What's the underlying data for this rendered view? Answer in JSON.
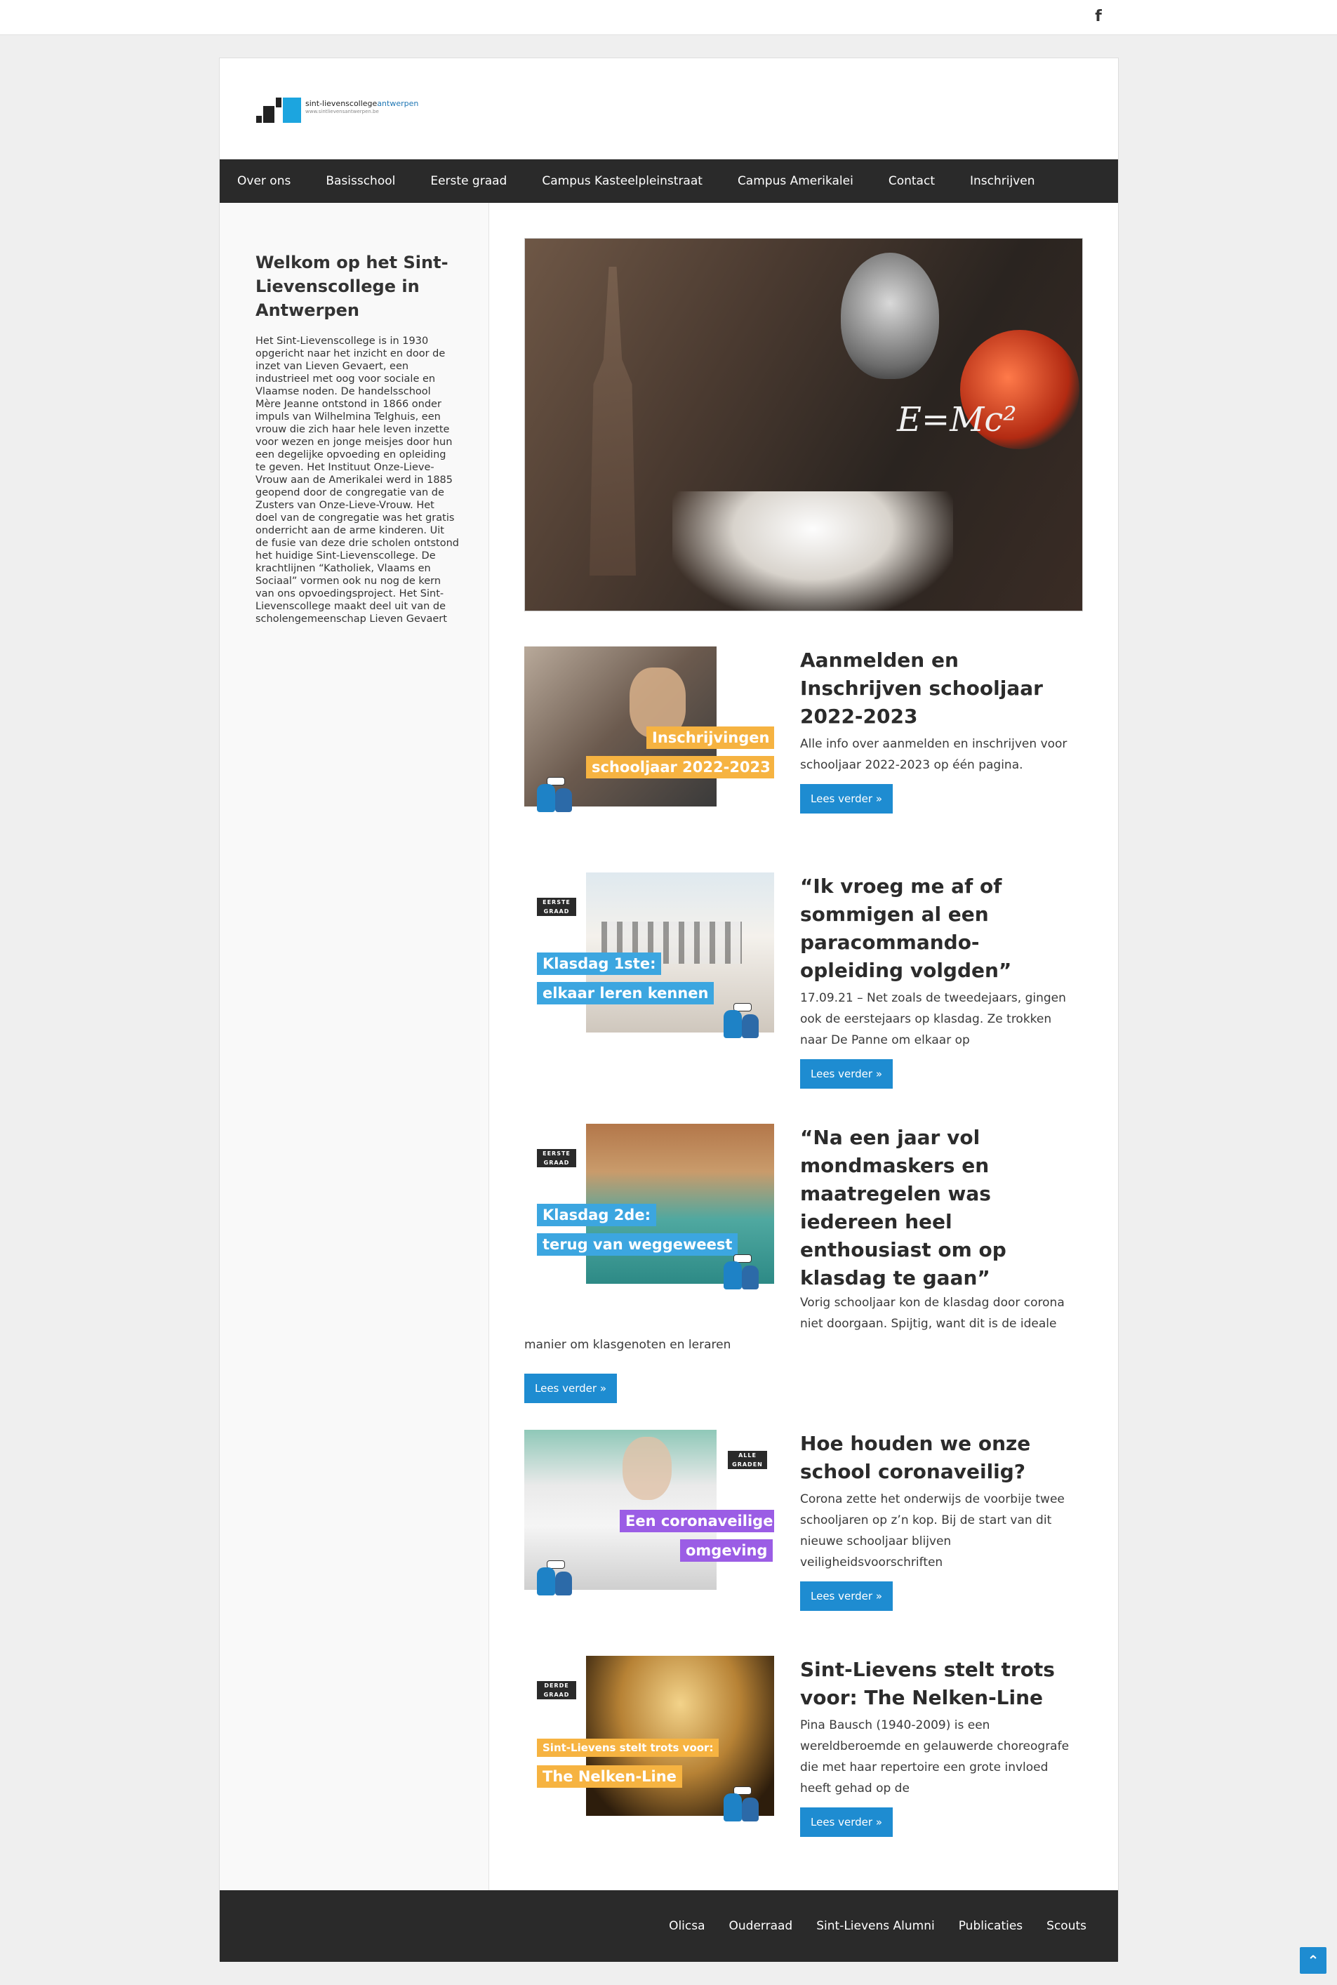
{
  "topbar": {
    "social_icon": "facebook-icon",
    "social_glyph": "f"
  },
  "logo": {
    "name_bold": "sint-lievenscollege",
    "name_accent": "antwerpen",
    "url": "www.sintlievensantwerpen.be"
  },
  "nav": {
    "items": [
      "Over ons",
      "Basisschool",
      "Eerste graad",
      "Campus Kasteelpleinstraat",
      "Campus Amerikalei",
      "Contact",
      "Inschrijven"
    ]
  },
  "sidebar": {
    "title": "Welkom op het Sint-Lievenscollege in Antwerpen",
    "about": "Het Sint-Lievenscollege is in 1930 opgericht naar het inzicht en door de inzet van Lieven Gevaert, een industrieel met oog voor sociale en Vlaamse noden. De handelsschool Mère Jeanne ontstond in 1866 onder impuls van Wilhelmina Telghuis, een vrouw die zich haar hele leven inzette voor wezen en jonge meisjes door hun een degelijke opvoeding en opleiding te geven. Het Instituut Onze-Lieve-Vrouw aan de Amerikalei werd in 1885 geopend door de congregatie van de Zusters van Onze-Lieve-Vrouw. Het doel van de congregatie was het gratis onderricht aan de arme kinderen. Uit de fusie van deze drie scholen ontstond het huidige Sint-Lievenscollege. De krachtlijnen “Katholiek, Vlaams en Sociaal” vormen ook nu nog de kern van ons opvoedingsproject. Het Sint-Lievenscollege maakt deel uit van de scholengemeenschap Lieven Gevaert"
  },
  "posts": [
    {
      "title": "Aanmelden en Inschrijven schooljaar 2022-2023",
      "excerpt": "Alle info over aanmelden en inschrijven voor schooljaar 2022-2023 op één pagina.",
      "button": "Lees verder »",
      "thumb_tags": [
        "Inschrijvingen",
        "schooljaar 2022-2023"
      ],
      "thumb_grade": [],
      "tag_color": "#f6b341"
    },
    {
      "title": "“Ik vroeg me af of sommigen al een paracommando-opleiding volgden”",
      "excerpt": "17.09.21 – Net zoals de tweedejaars, gingen ook de eerstejaars op klasdag. Ze trokken naar De Panne om elkaar op",
      "button": "Lees verder »",
      "thumb_tags": [
        "Klasdag 1ste:",
        "elkaar leren kennen"
      ],
      "thumb_grade": [
        "EERSTE",
        "GRAAD"
      ],
      "tag_color": "#3ca6e0"
    },
    {
      "title": "“Na een jaar vol mondmaskers en maatregelen was iedereen heel enthousiast om op klasdag te gaan”",
      "excerpt_line1": "Vorig schooljaar kon de klasdag door corona",
      "excerpt_line2": "niet doorgaan. Spijtig, want dit is de ideale",
      "excerpt_line3": "manier om klasgenoten en leraren",
      "button": "Lees verder »",
      "thumb_tags": [
        "Klasdag 2de:",
        "terug van weggeweest"
      ],
      "thumb_grade": [
        "EERSTE",
        "GRAAD"
      ],
      "tag_color": "#3ca6e0"
    },
    {
      "title": "Hoe houden we onze school coronaveilig?",
      "excerpt": "Corona zette het onderwijs de voorbije twee schooljaren op z’n kop. Bij de start van dit nieuwe schooljaar blijven veiligheidsvoorschriften",
      "button": "Lees verder »",
      "thumb_tags": [
        "Een coronaveilige",
        "omgeving"
      ],
      "thumb_grade": [
        "ALLE",
        "GRADEN"
      ],
      "tag_color": "#9b5de5"
    },
    {
      "title": "Sint-Lievens stelt trots voor: The Nelken-Line",
      "excerpt": "Pina Bausch (1940-2009) is een wereldberoemde en gelauwerde choreografe die met haar repertoire een grote invloed heeft gehad op de",
      "button": "Lees verder »",
      "thumb_tags": [
        "Sint-Lievens stelt trots voor:",
        "The Nelken-Line"
      ],
      "thumb_grade": [
        "DERDE",
        "GRAAD"
      ],
      "tag_color": "#f6b341"
    }
  ],
  "footer": {
    "items": [
      "Olicsa",
      "Ouderraad",
      "Sint-Lievens Alumni",
      "Publicaties",
      "Scouts"
    ]
  },
  "back_to_top": {
    "icon": "chevron-up-icon",
    "glyph": "⌃"
  }
}
